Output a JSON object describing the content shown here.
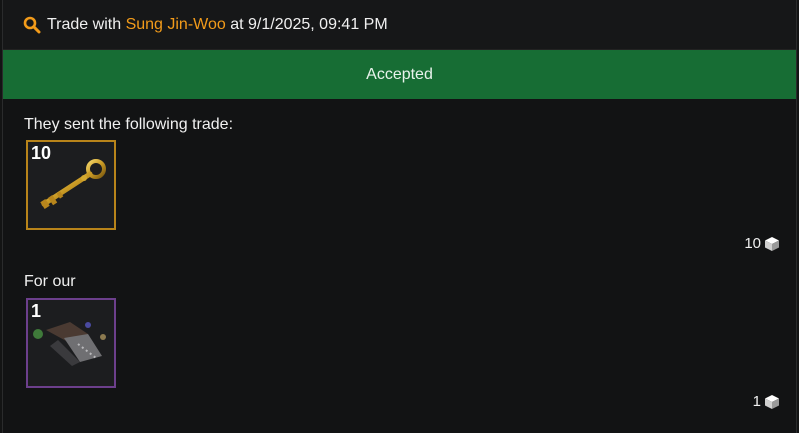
{
  "header": {
    "prefix": "Trade with",
    "partner_name": "Sung Jin-Woo",
    "suffix": "at 9/1/2025, 09:41 PM"
  },
  "status": {
    "label": "Accepted",
    "color": "#176d34"
  },
  "sent": {
    "label": "They sent the following trade:",
    "items": [
      {
        "quantity": "10",
        "icon": "key-icon",
        "border_color": "#b8841a"
      }
    ],
    "total": "10",
    "total_icon": "cube-icon"
  },
  "received": {
    "label": "For our",
    "items": [
      {
        "quantity": "1",
        "icon": "tool-icon",
        "border_color": "#6c3f8c"
      }
    ],
    "total": "1",
    "total_icon": "cube-icon"
  },
  "colors": {
    "accent": "#f29b1a",
    "background": "#121314"
  }
}
